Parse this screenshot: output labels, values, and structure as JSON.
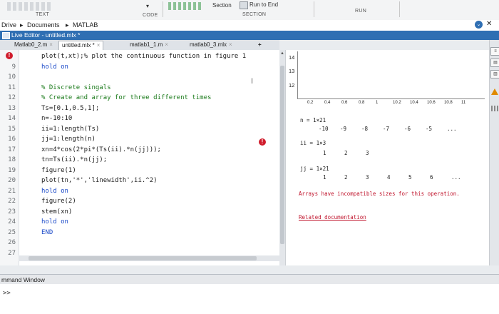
{
  "toolstrip": {
    "section_label": "Section",
    "run_to_end_label": "Run to End",
    "group_text": "TEXT",
    "group_code": "CODE",
    "group_section": "SECTION",
    "group_run": "RUN"
  },
  "address": {
    "drive": "Drive",
    "documents": "Documents",
    "matlab": "MATLAB",
    "sep": "▸"
  },
  "editor_title": "Live Editor - untitled.mlx *",
  "tabs": [
    {
      "label": "Matlab0_2.m"
    },
    {
      "label": "untitled.mlx *"
    },
    {
      "label": "matlab1_1.m"
    },
    {
      "label": "matlab0_3.mlx"
    },
    {
      "label": "+"
    }
  ],
  "code_lines": [
    {
      "num": "",
      "text": "plot(t,xt);% plot the continuous function in figure 1"
    },
    {
      "num": "9",
      "text": "hold on"
    },
    {
      "num": "10",
      "text": ""
    },
    {
      "num": "11",
      "text": "% Discrete singals"
    },
    {
      "num": "12",
      "text": "% Create and array for three different times"
    },
    {
      "num": "13",
      "text": "Ts=[0.1,0.5,1];"
    },
    {
      "num": "14",
      "text": "n=-10:10"
    },
    {
      "num": "15",
      "text": "ii=1:length(Ts)"
    },
    {
      "num": "16",
      "text": "jj=1:length(n)"
    },
    {
      "num": "17",
      "text": "xn=4*cos(2*pi*(Ts(ii).*n(jj)));"
    },
    {
      "num": "18",
      "text": "tn=Ts(ii).*n(jj);"
    },
    {
      "num": "19",
      "text": "figure(1)"
    },
    {
      "num": "20",
      "text": "plot(tn,'*','linewidth',ii.^2)"
    },
    {
      "num": "21",
      "text": "hold on"
    },
    {
      "num": "22",
      "text": "figure(2)"
    },
    {
      "num": "23",
      "text": "stem(xn)"
    },
    {
      "num": "24",
      "text": "hold on"
    },
    {
      "num": "25",
      "text": "END"
    },
    {
      "num": "26",
      "text": ""
    },
    {
      "num": "27",
      "text": ""
    }
  ],
  "output": {
    "plot_yticks": [
      "14",
      "13",
      "12"
    ],
    "plot_xticks": [
      "0.2",
      "0.4",
      "0.6",
      "0.8",
      "1",
      "10.2",
      "10.4",
      "10.6",
      "10.8",
      "11"
    ],
    "n_label": "n = 1×21",
    "n_values": [
      "-10",
      "-9",
      "-8",
      "-7",
      "-6",
      "-5",
      "..."
    ],
    "ii_label": "ii = 1×3",
    "ii_values": [
      "1",
      "2",
      "3"
    ],
    "jj_label": "jj = 1×21",
    "jj_values": [
      "1",
      "2",
      "3",
      "4",
      "5",
      "6",
      "..."
    ],
    "error_text": "Arrays have incompatible sizes for this operation.",
    "related_doc": "Related documentation"
  },
  "cmd": {
    "title": "mmand Window",
    "prompt": ">>"
  },
  "colors": {
    "title_blue": "#2f6fb3",
    "error_red": "#c0142c",
    "keyword_blue": "#1a49c8",
    "comment_green": "#1a7a1a"
  }
}
